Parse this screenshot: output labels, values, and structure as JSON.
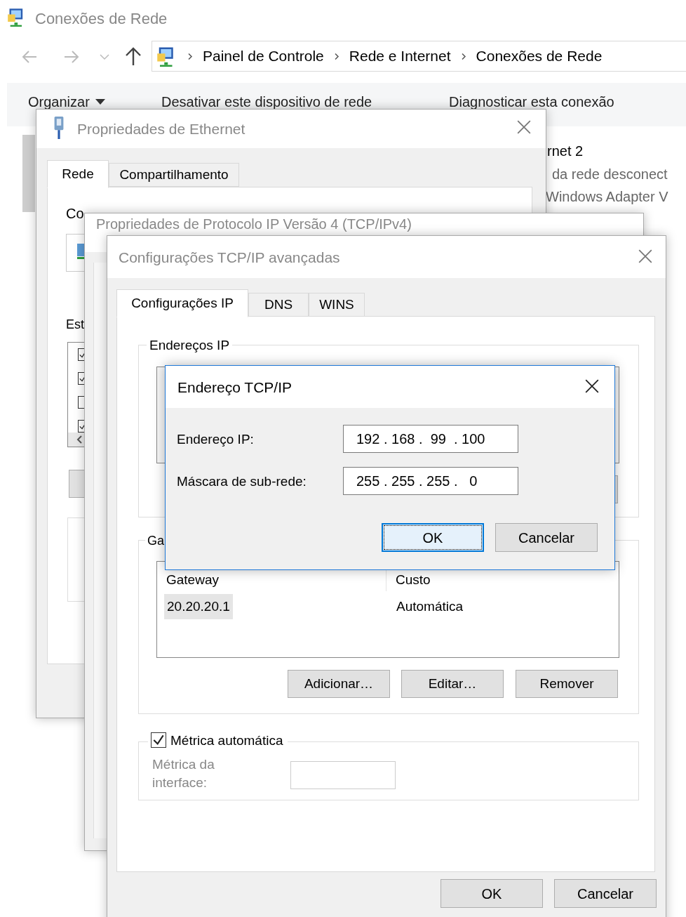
{
  "explorer": {
    "title": "Conexões de Rede",
    "breadcrumb": [
      "Painel de Controle",
      "Rede e Internet",
      "Conexões de Rede"
    ],
    "toolbar": [
      "Organizar",
      "Desativar este dispositivo de rede",
      "Diagnosticar esta conexão"
    ],
    "connection": {
      "name": "rnet 2",
      "status": "da rede desconect",
      "adapter": "Windows Adapter V"
    }
  },
  "ethernet_properties": {
    "title": "Propriedades de Ethernet",
    "tabs": [
      {
        "label": "Rede",
        "selected": true
      },
      {
        "label": "Compartilhamento",
        "selected": false
      }
    ],
    "connect_label": "Co",
    "items_label": "Est",
    "components": [
      {
        "checked": true
      },
      {
        "checked": true
      },
      {
        "checked": false
      },
      {
        "checked": true
      }
    ]
  },
  "ipv4_properties": {
    "title": "Propriedades de Protocolo IP Versão 4 (TCP/IPv4)"
  },
  "advanced": {
    "title": "Configurações TCP/IP avançadas",
    "tabs": [
      {
        "label": "Configurações IP",
        "selected": true
      },
      {
        "label": "DNS",
        "selected": false
      },
      {
        "label": "WINS",
        "selected": false
      }
    ],
    "ip_group": "Endereços IP",
    "gateway_group": "Ga",
    "gateway_columns": [
      "Gateway",
      "Custo"
    ],
    "gateways": [
      {
        "gateway": "20.20.20.1",
        "cost": "Automática",
        "selected": true
      }
    ],
    "gateway_buttons": [
      "Adicionar…",
      "Editar…",
      "Remover"
    ],
    "automatic_metric": {
      "label": "Métrica automática",
      "checked": true
    },
    "interface_metric": {
      "label": "Métrica da interface:",
      "disabled": true
    },
    "buttons": [
      "OK",
      "Cancelar"
    ]
  },
  "address_dialog": {
    "title": "Endereço TCP/IP",
    "fields": [
      {
        "label": "Endereço IP:",
        "value": "192 . 168 .  99  . 100"
      },
      {
        "label": "Máscara de sub-rede:",
        "value": "255 . 255 . 255 .   0"
      }
    ],
    "buttons": [
      {
        "label": "OK",
        "default": true
      },
      {
        "label": "Cancelar",
        "default": false
      }
    ]
  }
}
